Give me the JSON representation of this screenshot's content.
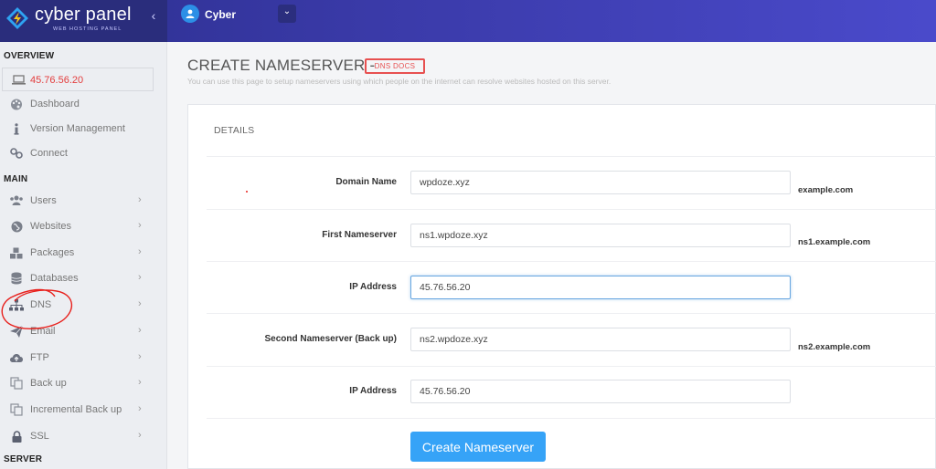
{
  "brand": {
    "name": "cyber panel",
    "tagline": "WEB HOSTING PANEL"
  },
  "topbar": {
    "collapse_glyph": "‹",
    "user_name": "Cyber",
    "dropdown_glyph": "⌄"
  },
  "sidebar": {
    "overview_heading": "OVERVIEW",
    "server_ip": "45.76.56.20",
    "overview_items": [
      {
        "label": "Dashboard",
        "icon": "palette-icon"
      },
      {
        "label": "Version Management",
        "icon": "info-icon"
      },
      {
        "label": "Connect",
        "icon": "link-icon"
      }
    ],
    "main_heading": "MAIN",
    "main_items": [
      {
        "label": "Users",
        "icon": "users-icon"
      },
      {
        "label": "Websites",
        "icon": "globe-icon"
      },
      {
        "label": "Packages",
        "icon": "cubes-icon"
      },
      {
        "label": "Databases",
        "icon": "database-icon"
      },
      {
        "label": "DNS",
        "icon": "sitemap-icon"
      },
      {
        "label": "Email",
        "icon": "paper-plane-icon"
      },
      {
        "label": "FTP",
        "icon": "cloud-upload-icon"
      },
      {
        "label": "Back up",
        "icon": "copy-icon"
      },
      {
        "label": "Incremental Back up",
        "icon": "copy-icon"
      },
      {
        "label": "SSL",
        "icon": "lock-icon"
      }
    ],
    "chevron": "›",
    "server_heading": "SERVER"
  },
  "page": {
    "title": "CREATE NAMESERVER -",
    "docs_label": "DNS DOCS",
    "subtitle": "You can use this page to setup nameservers using which people on the internet can resolve websites hosted on this server."
  },
  "form": {
    "section_title": "DETAILS",
    "fields": [
      {
        "label": "Domain Name",
        "value": "wpdoze.xyz",
        "hint": "example.com"
      },
      {
        "label": "First Nameserver",
        "value": "ns1.wpdoze.xyz",
        "hint": "ns1.example.com"
      },
      {
        "label": "IP Address",
        "value": "45.76.56.20",
        "hint": ""
      },
      {
        "label": "Second Nameserver (Back up)",
        "value": "ns2.wpdoze.xyz",
        "hint": "ns2.example.com"
      },
      {
        "label": "IP Address",
        "value": "45.76.56.20",
        "hint": ""
      }
    ],
    "submit_label": "Create Nameserver"
  },
  "colors": {
    "topbar": "#3a3aa8",
    "accent_red": "#e75050",
    "button": "#36a3f7",
    "annotation": "#e8201c"
  }
}
